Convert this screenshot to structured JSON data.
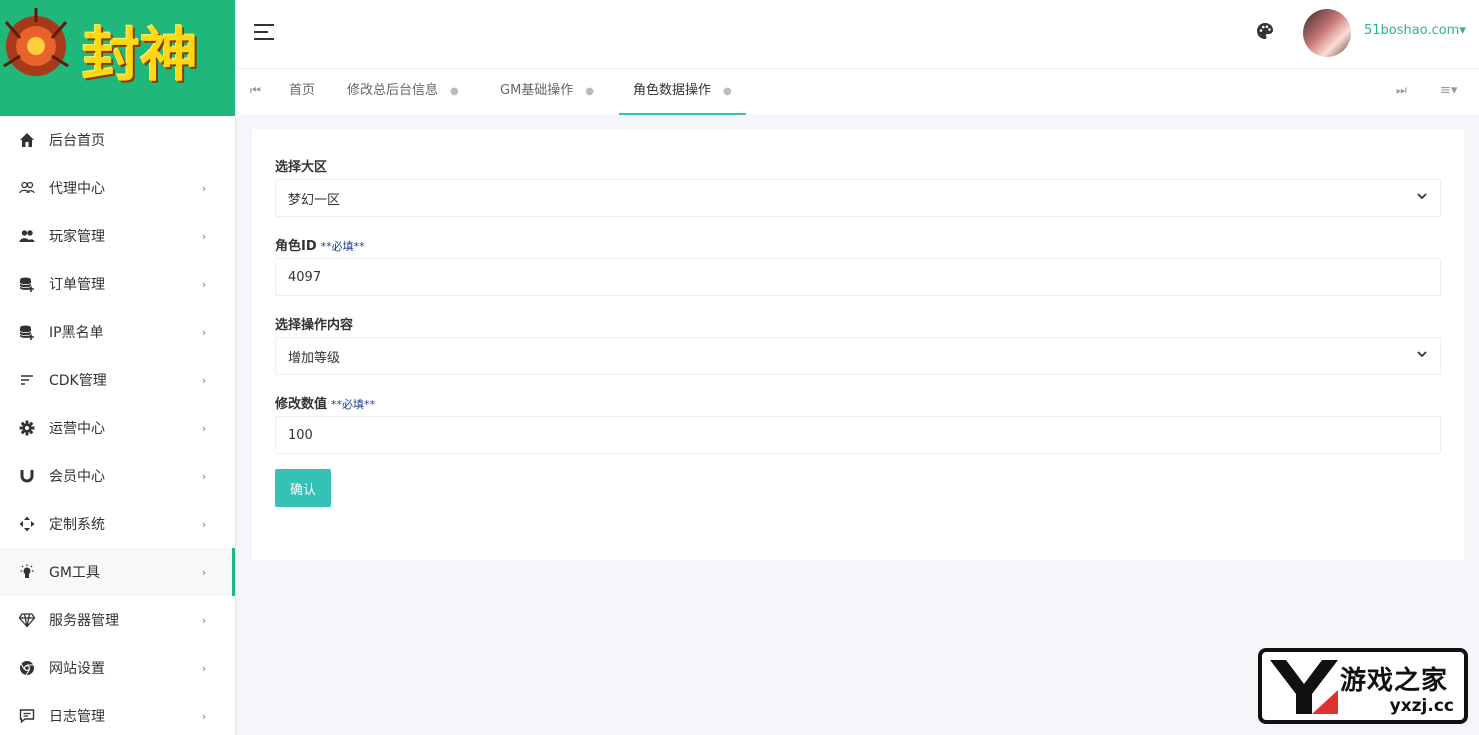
{
  "logo": {
    "text": "封神"
  },
  "sidebar": {
    "items": [
      {
        "label": "后台首页",
        "icon": "home-icon"
      },
      {
        "label": "代理中心",
        "icon": "users-outline-icon"
      },
      {
        "label": "玩家管理",
        "icon": "users-icon"
      },
      {
        "label": "订单管理",
        "icon": "database-plus-icon"
      },
      {
        "label": "IP黑名单",
        "icon": "database-plus-icon"
      },
      {
        "label": "CDK管理",
        "icon": "list-lines-icon"
      },
      {
        "label": "运营中心",
        "icon": "gear-icon"
      },
      {
        "label": "会员中心",
        "icon": "magnet-icon"
      },
      {
        "label": "定制系统",
        "icon": "move-arrows-icon"
      },
      {
        "label": "GM工具",
        "icon": "bulb-icon"
      },
      {
        "label": "服务器管理",
        "icon": "diamond-icon"
      },
      {
        "label": "网站设置",
        "icon": "chrome-circle-icon"
      },
      {
        "label": "日志管理",
        "icon": "message-icon"
      }
    ],
    "active_index": 9
  },
  "header": {
    "username": "51boshao.com▾"
  },
  "tabs": {
    "first_icon": "⏮",
    "last_icon": "⏭",
    "menu_icon": "≡▾",
    "items": [
      {
        "label": "首页",
        "closable": false
      },
      {
        "label": "修改总后台信息",
        "closable": true
      },
      {
        "label": "GM基础操作",
        "closable": true
      },
      {
        "label": "角色数据操作",
        "closable": true
      }
    ],
    "active_index": 3
  },
  "form": {
    "region_label": "选择大区",
    "region_value": "梦幻一区",
    "role_id_label": "角色ID",
    "role_id_required": "**必填**",
    "role_id_value": "4097",
    "operation_label": "选择操作内容",
    "operation_value": "增加等级",
    "amount_label": "修改数值",
    "amount_required": "**必填**",
    "amount_value": "100",
    "confirm_label": "确认"
  },
  "watermark": {
    "title": "游戏之家",
    "domain": "yxzj.cc"
  },
  "colors": {
    "accent": "#35c2b5",
    "logo_bg": "#1fb77a",
    "active_bar": "#1fb37f"
  }
}
